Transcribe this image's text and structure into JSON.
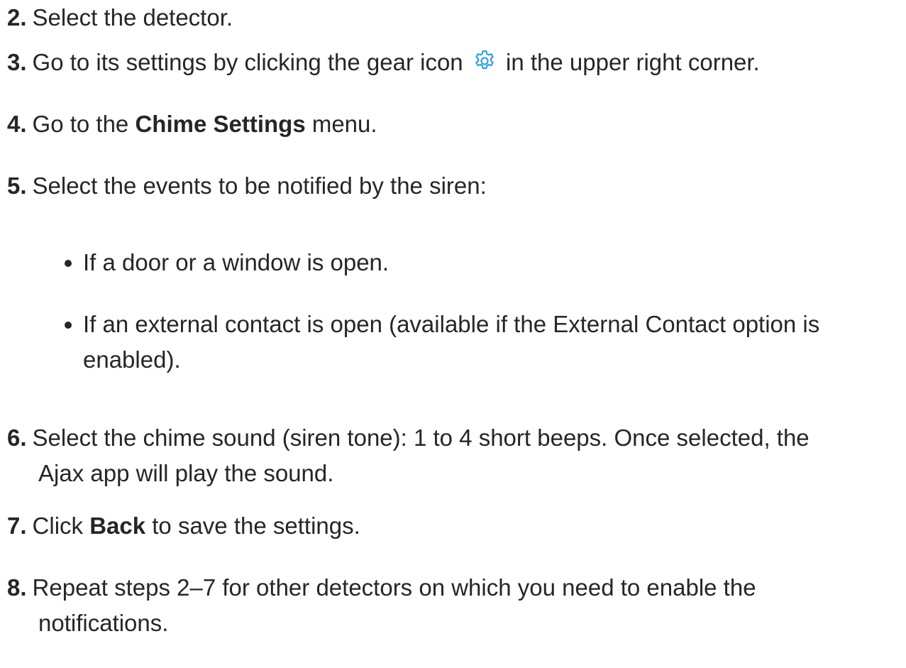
{
  "steps": [
    {
      "num": "2.",
      "text": "Select the detector."
    },
    {
      "num": "3.",
      "pre": "Go to its settings by clicking the gear icon",
      "post": "in the upper right corner."
    },
    {
      "num": "4.",
      "pre": "Go to the",
      "bold": "Chime Settings",
      "post": "menu."
    },
    {
      "num": "5.",
      "text": "Select the events to be notified by the siren:"
    },
    {
      "num": "6.",
      "line1": "Select the chime sound (siren tone): 1 to 4 short beeps. Once selected, the",
      "line2": "Ajax app will play the sound."
    },
    {
      "num": "7.",
      "pre": "Click",
      "bold": "Back",
      "post": "to save the settings."
    },
    {
      "num": "8.",
      "line1": "Repeat steps 2–7 for other detectors on which you need to enable the",
      "line2": "notifications."
    }
  ],
  "bullets": [
    {
      "line1": "If a door or a window is open."
    },
    {
      "line1": "If an external contact is open (available if the External Contact option is",
      "line2": "enabled)."
    }
  ],
  "colors": {
    "text": "#262626",
    "gear_icon": "#2e9fd6"
  },
  "icons": {
    "gear": "gear-icon"
  }
}
